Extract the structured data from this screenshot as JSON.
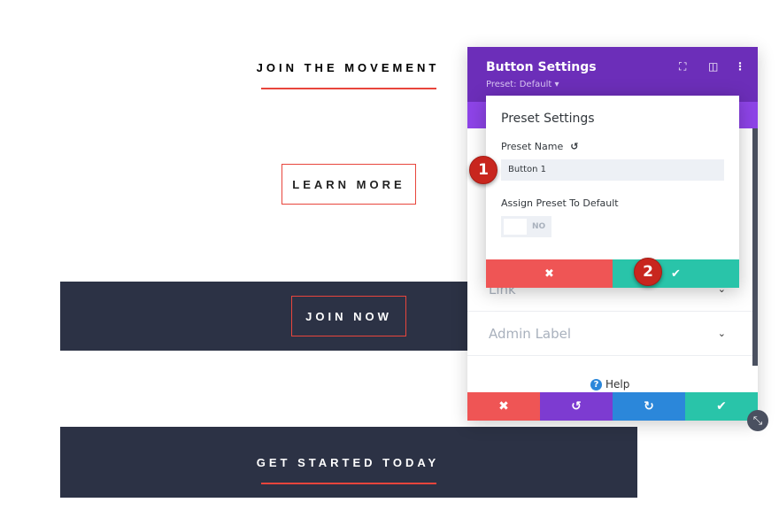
{
  "page": {
    "heading1": "JOIN THE MOVEMENT",
    "learn_more": "LEARN MORE",
    "join_now": "JOIN NOW",
    "get_started": "GET STARTED TODAY"
  },
  "panel": {
    "title": "Button Settings",
    "preset": "Preset: Default ▾",
    "rows": [
      {
        "label": "Link"
      },
      {
        "label": "Admin Label"
      }
    ],
    "help": "Help",
    "colors": {
      "header": "#6c2eb9",
      "tabs": "#8e44e8",
      "cancel": "#ef5555",
      "undo": "#7d3bd1",
      "redo": "#2b87da",
      "save": "#29c4a9"
    }
  },
  "popup": {
    "title": "Preset Settings",
    "name_label": "Preset Name",
    "name_value": "Button 1",
    "assign_label": "Assign Preset To Default",
    "toggle_value": "NO"
  },
  "badges": [
    "1",
    "2"
  ],
  "icons": {
    "close": "✖",
    "check": "✔",
    "undo": "↺",
    "redo": "↻"
  }
}
